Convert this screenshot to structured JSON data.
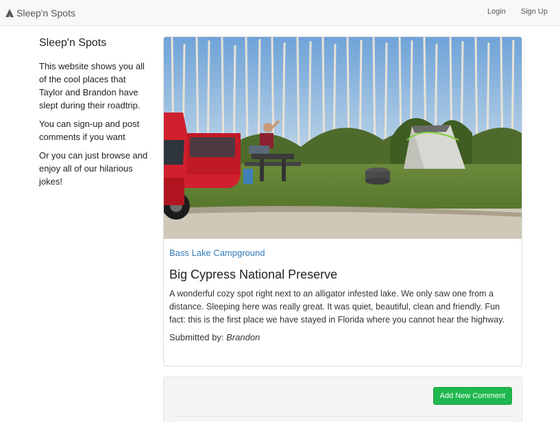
{
  "navbar": {
    "brand": "Sleep'n Spots",
    "brand_icon": "tent-icon",
    "links": {
      "login": "Login",
      "signup": "Sign Up"
    }
  },
  "sidebar": {
    "title": "Sleep'n Spots",
    "paragraphs": [
      "This website shows you all of the cool places that Taylor and Brandon have slept during their roadtrip.",
      "You can sign-up and post comments if you want",
      "Or you can just browse and enjoy all of our hilarious jokes!"
    ]
  },
  "spot": {
    "place_link": "Bass Lake Campground",
    "title": "Big Cypress National Preserve",
    "description": "A wonderful cozy spot right next to an alligator infested lake. We only saw one from a distance. Sleeping here was really great. It was quiet, beautiful, clean and friendly. Fun fact: this is the first place we have stayed in Florida where you cannot hear the highway.",
    "submitted_label": "Submitted by:",
    "author": "Brandon"
  },
  "comments": {
    "add_button": "Add New Comment"
  },
  "colors": {
    "link": "#337ab7",
    "button": "#1fb84e"
  }
}
